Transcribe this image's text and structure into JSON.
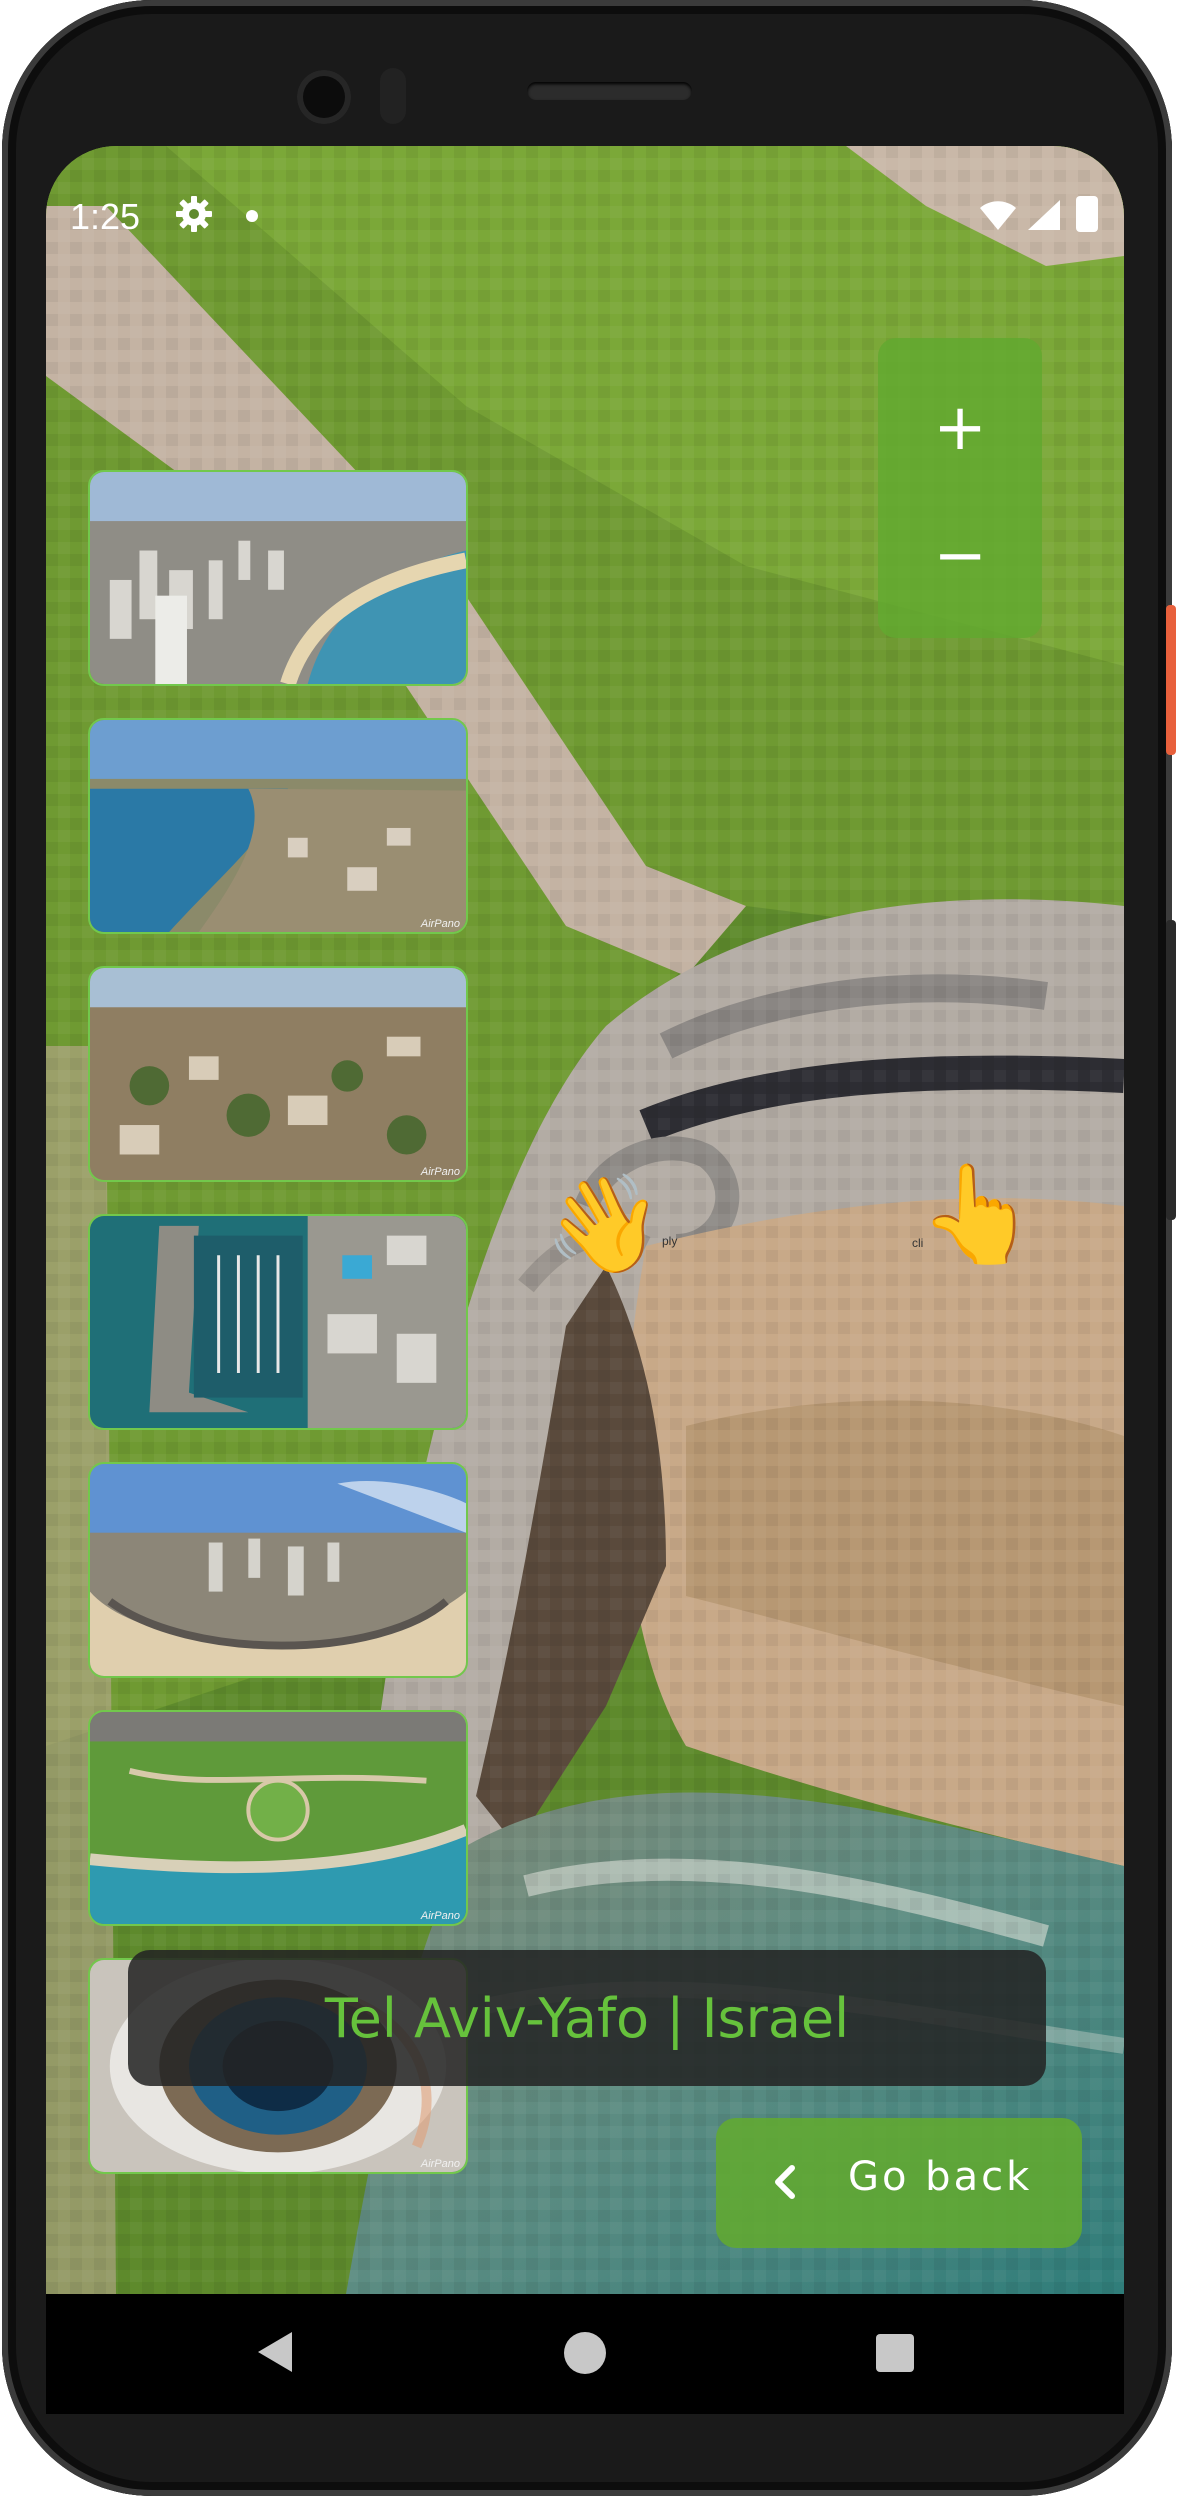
{
  "status_bar": {
    "time": "1:25",
    "icons": [
      "gear-icon",
      "notification-dot-icon",
      "wifi-icon",
      "signal-icon",
      "battery-icon"
    ]
  },
  "zoom": {
    "in_label": "+",
    "out_label": "−"
  },
  "thumbnails": [
    {
      "name": "thumb-city-beach",
      "watermark": ""
    },
    {
      "name": "thumb-coast-bay",
      "watermark": "AirPano"
    },
    {
      "name": "thumb-old-city",
      "watermark": "AirPano"
    },
    {
      "name": "thumb-marina",
      "watermark": ""
    },
    {
      "name": "thumb-curved-beach",
      "watermark": ""
    },
    {
      "name": "thumb-park-coast",
      "watermark": "AirPano"
    },
    {
      "name": "thumb-tiny-planet",
      "watermark": "AirPano"
    }
  ],
  "hands": {
    "left_label": "ply",
    "right_label": "cli"
  },
  "banner": {
    "title": "Tel Aviv-Yafo | Israel"
  },
  "go_back": {
    "label": "Go back"
  },
  "colors": {
    "accent": "#62aa30",
    "title_text": "#66c23c",
    "banner_bg": "#232323"
  }
}
